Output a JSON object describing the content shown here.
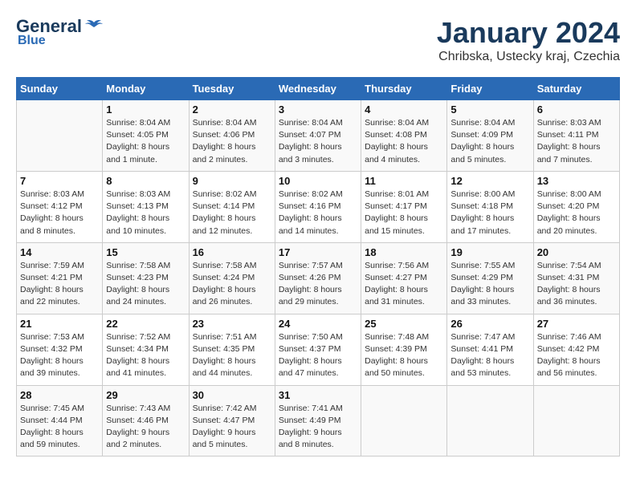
{
  "logo": {
    "text1": "General",
    "text2": "Blue"
  },
  "title": "January 2024",
  "subtitle": "Chribska, Ustecky kraj, Czechia",
  "days_header": [
    "Sunday",
    "Monday",
    "Tuesday",
    "Wednesday",
    "Thursday",
    "Friday",
    "Saturday"
  ],
  "weeks": [
    [
      {
        "num": "",
        "info": ""
      },
      {
        "num": "1",
        "info": "Sunrise: 8:04 AM\nSunset: 4:05 PM\nDaylight: 8 hours\nand 1 minute."
      },
      {
        "num": "2",
        "info": "Sunrise: 8:04 AM\nSunset: 4:06 PM\nDaylight: 8 hours\nand 2 minutes."
      },
      {
        "num": "3",
        "info": "Sunrise: 8:04 AM\nSunset: 4:07 PM\nDaylight: 8 hours\nand 3 minutes."
      },
      {
        "num": "4",
        "info": "Sunrise: 8:04 AM\nSunset: 4:08 PM\nDaylight: 8 hours\nand 4 minutes."
      },
      {
        "num": "5",
        "info": "Sunrise: 8:04 AM\nSunset: 4:09 PM\nDaylight: 8 hours\nand 5 minutes."
      },
      {
        "num": "6",
        "info": "Sunrise: 8:03 AM\nSunset: 4:11 PM\nDaylight: 8 hours\nand 7 minutes."
      }
    ],
    [
      {
        "num": "7",
        "info": "Sunrise: 8:03 AM\nSunset: 4:12 PM\nDaylight: 8 hours\nand 8 minutes."
      },
      {
        "num": "8",
        "info": "Sunrise: 8:03 AM\nSunset: 4:13 PM\nDaylight: 8 hours\nand 10 minutes."
      },
      {
        "num": "9",
        "info": "Sunrise: 8:02 AM\nSunset: 4:14 PM\nDaylight: 8 hours\nand 12 minutes."
      },
      {
        "num": "10",
        "info": "Sunrise: 8:02 AM\nSunset: 4:16 PM\nDaylight: 8 hours\nand 14 minutes."
      },
      {
        "num": "11",
        "info": "Sunrise: 8:01 AM\nSunset: 4:17 PM\nDaylight: 8 hours\nand 15 minutes."
      },
      {
        "num": "12",
        "info": "Sunrise: 8:00 AM\nSunset: 4:18 PM\nDaylight: 8 hours\nand 17 minutes."
      },
      {
        "num": "13",
        "info": "Sunrise: 8:00 AM\nSunset: 4:20 PM\nDaylight: 8 hours\nand 20 minutes."
      }
    ],
    [
      {
        "num": "14",
        "info": "Sunrise: 7:59 AM\nSunset: 4:21 PM\nDaylight: 8 hours\nand 22 minutes."
      },
      {
        "num": "15",
        "info": "Sunrise: 7:58 AM\nSunset: 4:23 PM\nDaylight: 8 hours\nand 24 minutes."
      },
      {
        "num": "16",
        "info": "Sunrise: 7:58 AM\nSunset: 4:24 PM\nDaylight: 8 hours\nand 26 minutes."
      },
      {
        "num": "17",
        "info": "Sunrise: 7:57 AM\nSunset: 4:26 PM\nDaylight: 8 hours\nand 29 minutes."
      },
      {
        "num": "18",
        "info": "Sunrise: 7:56 AM\nSunset: 4:27 PM\nDaylight: 8 hours\nand 31 minutes."
      },
      {
        "num": "19",
        "info": "Sunrise: 7:55 AM\nSunset: 4:29 PM\nDaylight: 8 hours\nand 33 minutes."
      },
      {
        "num": "20",
        "info": "Sunrise: 7:54 AM\nSunset: 4:31 PM\nDaylight: 8 hours\nand 36 minutes."
      }
    ],
    [
      {
        "num": "21",
        "info": "Sunrise: 7:53 AM\nSunset: 4:32 PM\nDaylight: 8 hours\nand 39 minutes."
      },
      {
        "num": "22",
        "info": "Sunrise: 7:52 AM\nSunset: 4:34 PM\nDaylight: 8 hours\nand 41 minutes."
      },
      {
        "num": "23",
        "info": "Sunrise: 7:51 AM\nSunset: 4:35 PM\nDaylight: 8 hours\nand 44 minutes."
      },
      {
        "num": "24",
        "info": "Sunrise: 7:50 AM\nSunset: 4:37 PM\nDaylight: 8 hours\nand 47 minutes."
      },
      {
        "num": "25",
        "info": "Sunrise: 7:48 AM\nSunset: 4:39 PM\nDaylight: 8 hours\nand 50 minutes."
      },
      {
        "num": "26",
        "info": "Sunrise: 7:47 AM\nSunset: 4:41 PM\nDaylight: 8 hours\nand 53 minutes."
      },
      {
        "num": "27",
        "info": "Sunrise: 7:46 AM\nSunset: 4:42 PM\nDaylight: 8 hours\nand 56 minutes."
      }
    ],
    [
      {
        "num": "28",
        "info": "Sunrise: 7:45 AM\nSunset: 4:44 PM\nDaylight: 8 hours\nand 59 minutes."
      },
      {
        "num": "29",
        "info": "Sunrise: 7:43 AM\nSunset: 4:46 PM\nDaylight: 9 hours\nand 2 minutes."
      },
      {
        "num": "30",
        "info": "Sunrise: 7:42 AM\nSunset: 4:47 PM\nDaylight: 9 hours\nand 5 minutes."
      },
      {
        "num": "31",
        "info": "Sunrise: 7:41 AM\nSunset: 4:49 PM\nDaylight: 9 hours\nand 8 minutes."
      },
      {
        "num": "",
        "info": ""
      },
      {
        "num": "",
        "info": ""
      },
      {
        "num": "",
        "info": ""
      }
    ]
  ]
}
